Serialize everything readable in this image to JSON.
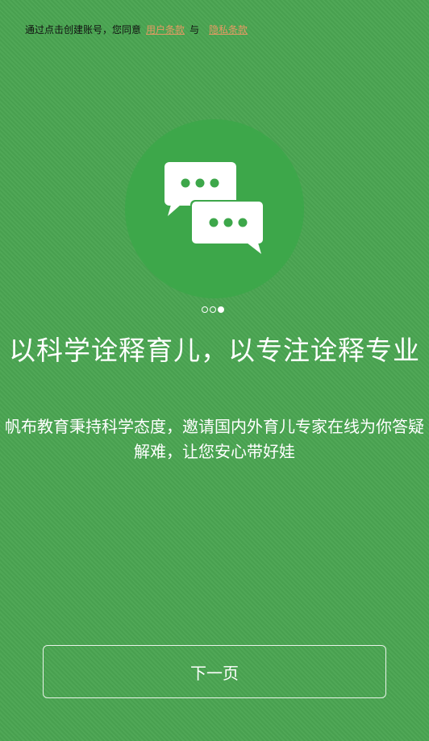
{
  "terms": {
    "prefix": "通过点击创建账号，您同意",
    "user_terms": "用户条款",
    "conjunction": "与",
    "privacy_terms": "隐私条款"
  },
  "carousel": {
    "slide_count": 3,
    "active_index": 2,
    "icon": "chat-bubbles-icon"
  },
  "headline": "以科学诠释育儿，以专注诠释专业",
  "subtext": "帆布教育秉持科学态度，邀请国内外育儿专家在线为你答疑解难，让您安心带好娃",
  "next_button_label": "下一页",
  "colors": {
    "background": "#4aa552",
    "circle": "#3da74a",
    "link": "#e59a63",
    "text": "#ffffff"
  }
}
